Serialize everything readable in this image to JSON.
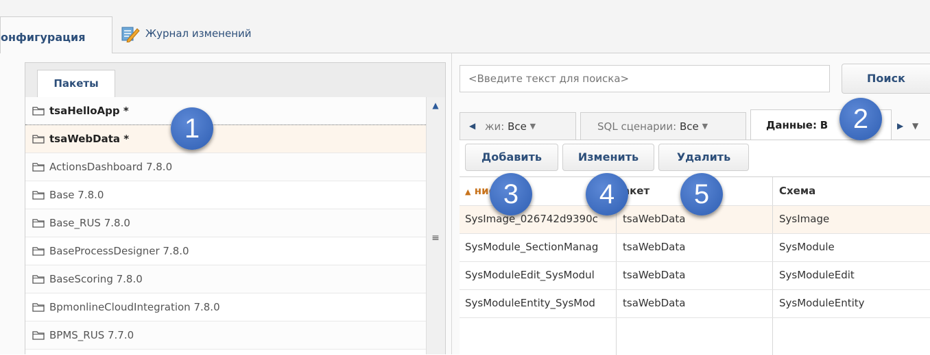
{
  "top_tabs": {
    "configuration": "онфигурация",
    "journal": "Журнал изменений"
  },
  "packages": {
    "tab_label": "Пакеты",
    "items": [
      {
        "label": "tsaHelloApp *",
        "modified": true
      },
      {
        "label": "tsaWebData *",
        "modified": true
      },
      {
        "label": "ActionsDashboard 7.8.0",
        "modified": false
      },
      {
        "label": "Base 7.8.0",
        "modified": false
      },
      {
        "label": "Base_RUS 7.8.0",
        "modified": false
      },
      {
        "label": "BaseProcessDesigner 7.8.0",
        "modified": false
      },
      {
        "label": "BaseScoring 7.8.0",
        "modified": false
      },
      {
        "label": "BpmonlineCloudIntegration 7.8.0",
        "modified": false
      },
      {
        "label": "BPMS_RUS 7.7.0",
        "modified": false
      }
    ],
    "scroll_grip": "≡"
  },
  "search": {
    "placeholder": "<Введите текст для поиска>",
    "button_label": "Поиск"
  },
  "filter_tabs": [
    {
      "label": "жи:",
      "value": "Все"
    },
    {
      "label": "SQL сценарии:",
      "value": "Все"
    },
    {
      "label": "Данные:",
      "value": "В"
    }
  ],
  "toolbar": {
    "add": "Добавить",
    "edit": "Изменить",
    "delete": "Удалить"
  },
  "grid": {
    "headers": [
      "ние",
      "акет",
      "Схема"
    ],
    "rows": [
      [
        "SysImage_026742d9390c",
        "tsaWebData",
        "SysImage"
      ],
      [
        "SysModule_SectionManag",
        "tsaWebData",
        "SysModule"
      ],
      [
        "SysModuleEdit_SysModul",
        "tsaWebData",
        "SysModuleEdit"
      ],
      [
        "SysModuleEntity_SysMod",
        "tsaWebData",
        "SysModuleEntity"
      ]
    ]
  },
  "callouts": [
    "1",
    "2",
    "3",
    "4",
    "5"
  ],
  "colors": {
    "accent": "#2d4f7a",
    "sort_header": "#c8741e",
    "callout": "#3a6bc4",
    "selection": "#fdf5ec"
  }
}
